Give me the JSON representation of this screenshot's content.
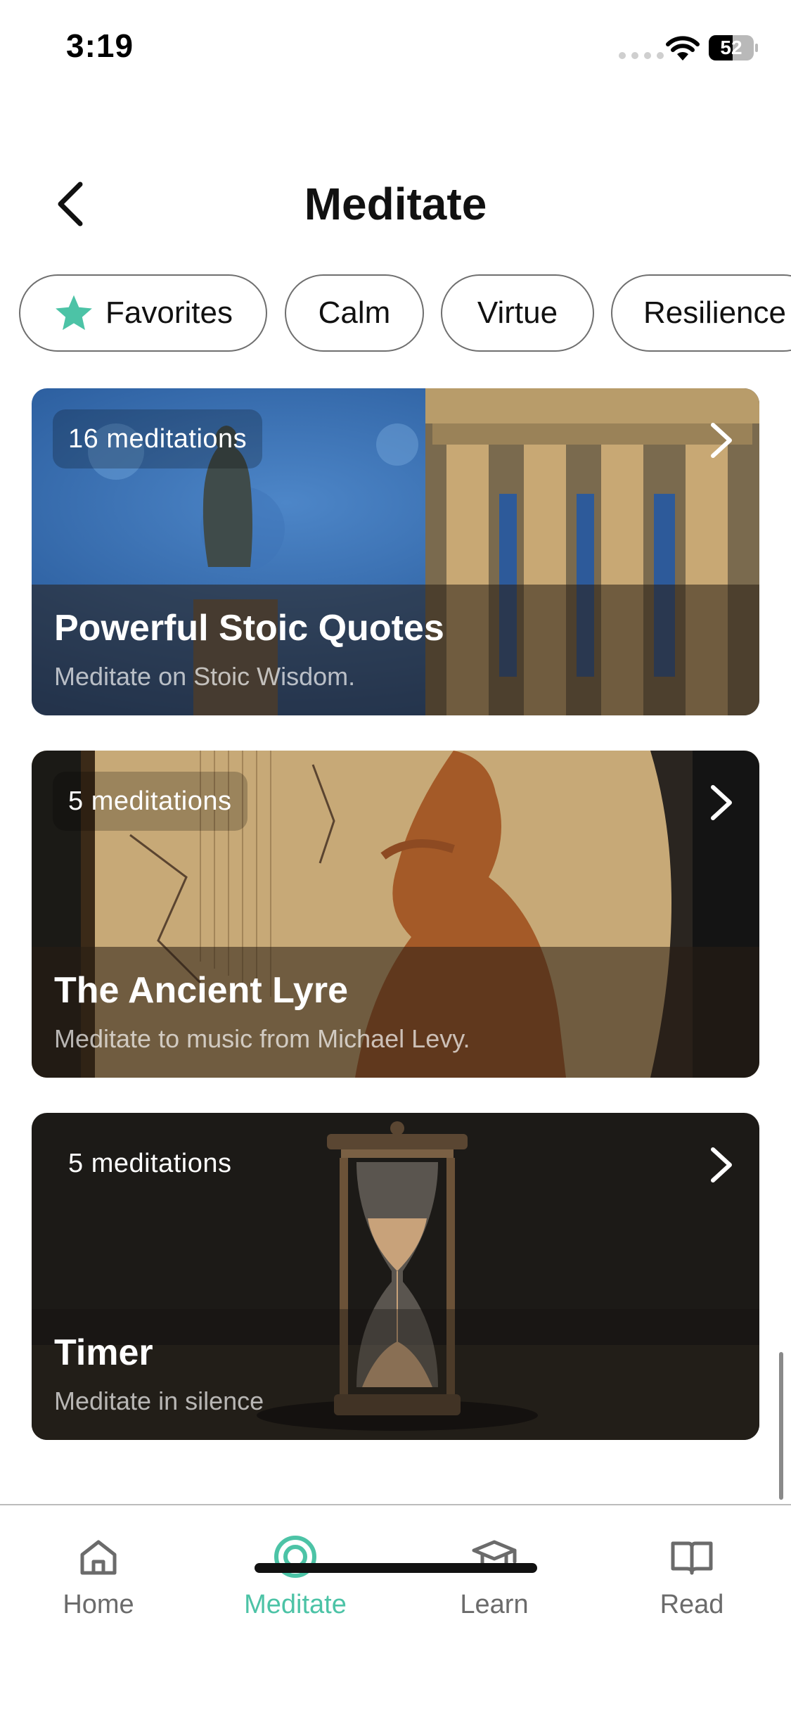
{
  "status_bar": {
    "time": "3:19",
    "battery": "52"
  },
  "header": {
    "title": "Meditate"
  },
  "filters": [
    "Favorites",
    "Calm",
    "Virtue",
    "Resilience"
  ],
  "cards": [
    {
      "count": "16 meditations",
      "title": "Powerful Stoic Quotes",
      "subtitle": "Meditate on Stoic Wisdom."
    },
    {
      "count": "5 meditations",
      "title": "The Ancient Lyre",
      "subtitle": "Meditate to music from Michael Levy."
    },
    {
      "count": "5 meditations",
      "title": "Timer",
      "subtitle": "Meditate in silence"
    }
  ],
  "tabs": [
    {
      "label": "Home",
      "icon": "home-icon",
      "active": false
    },
    {
      "label": "Meditate",
      "icon": "meditate-icon",
      "active": true
    },
    {
      "label": "Learn",
      "icon": "graduation-cap-icon",
      "active": false
    },
    {
      "label": "Read",
      "icon": "book-icon",
      "active": false
    }
  ],
  "colors": {
    "accent": "#4cc3a6",
    "tab_inactive": "#6b6b6b",
    "chip_border": "#6f6f6f"
  }
}
